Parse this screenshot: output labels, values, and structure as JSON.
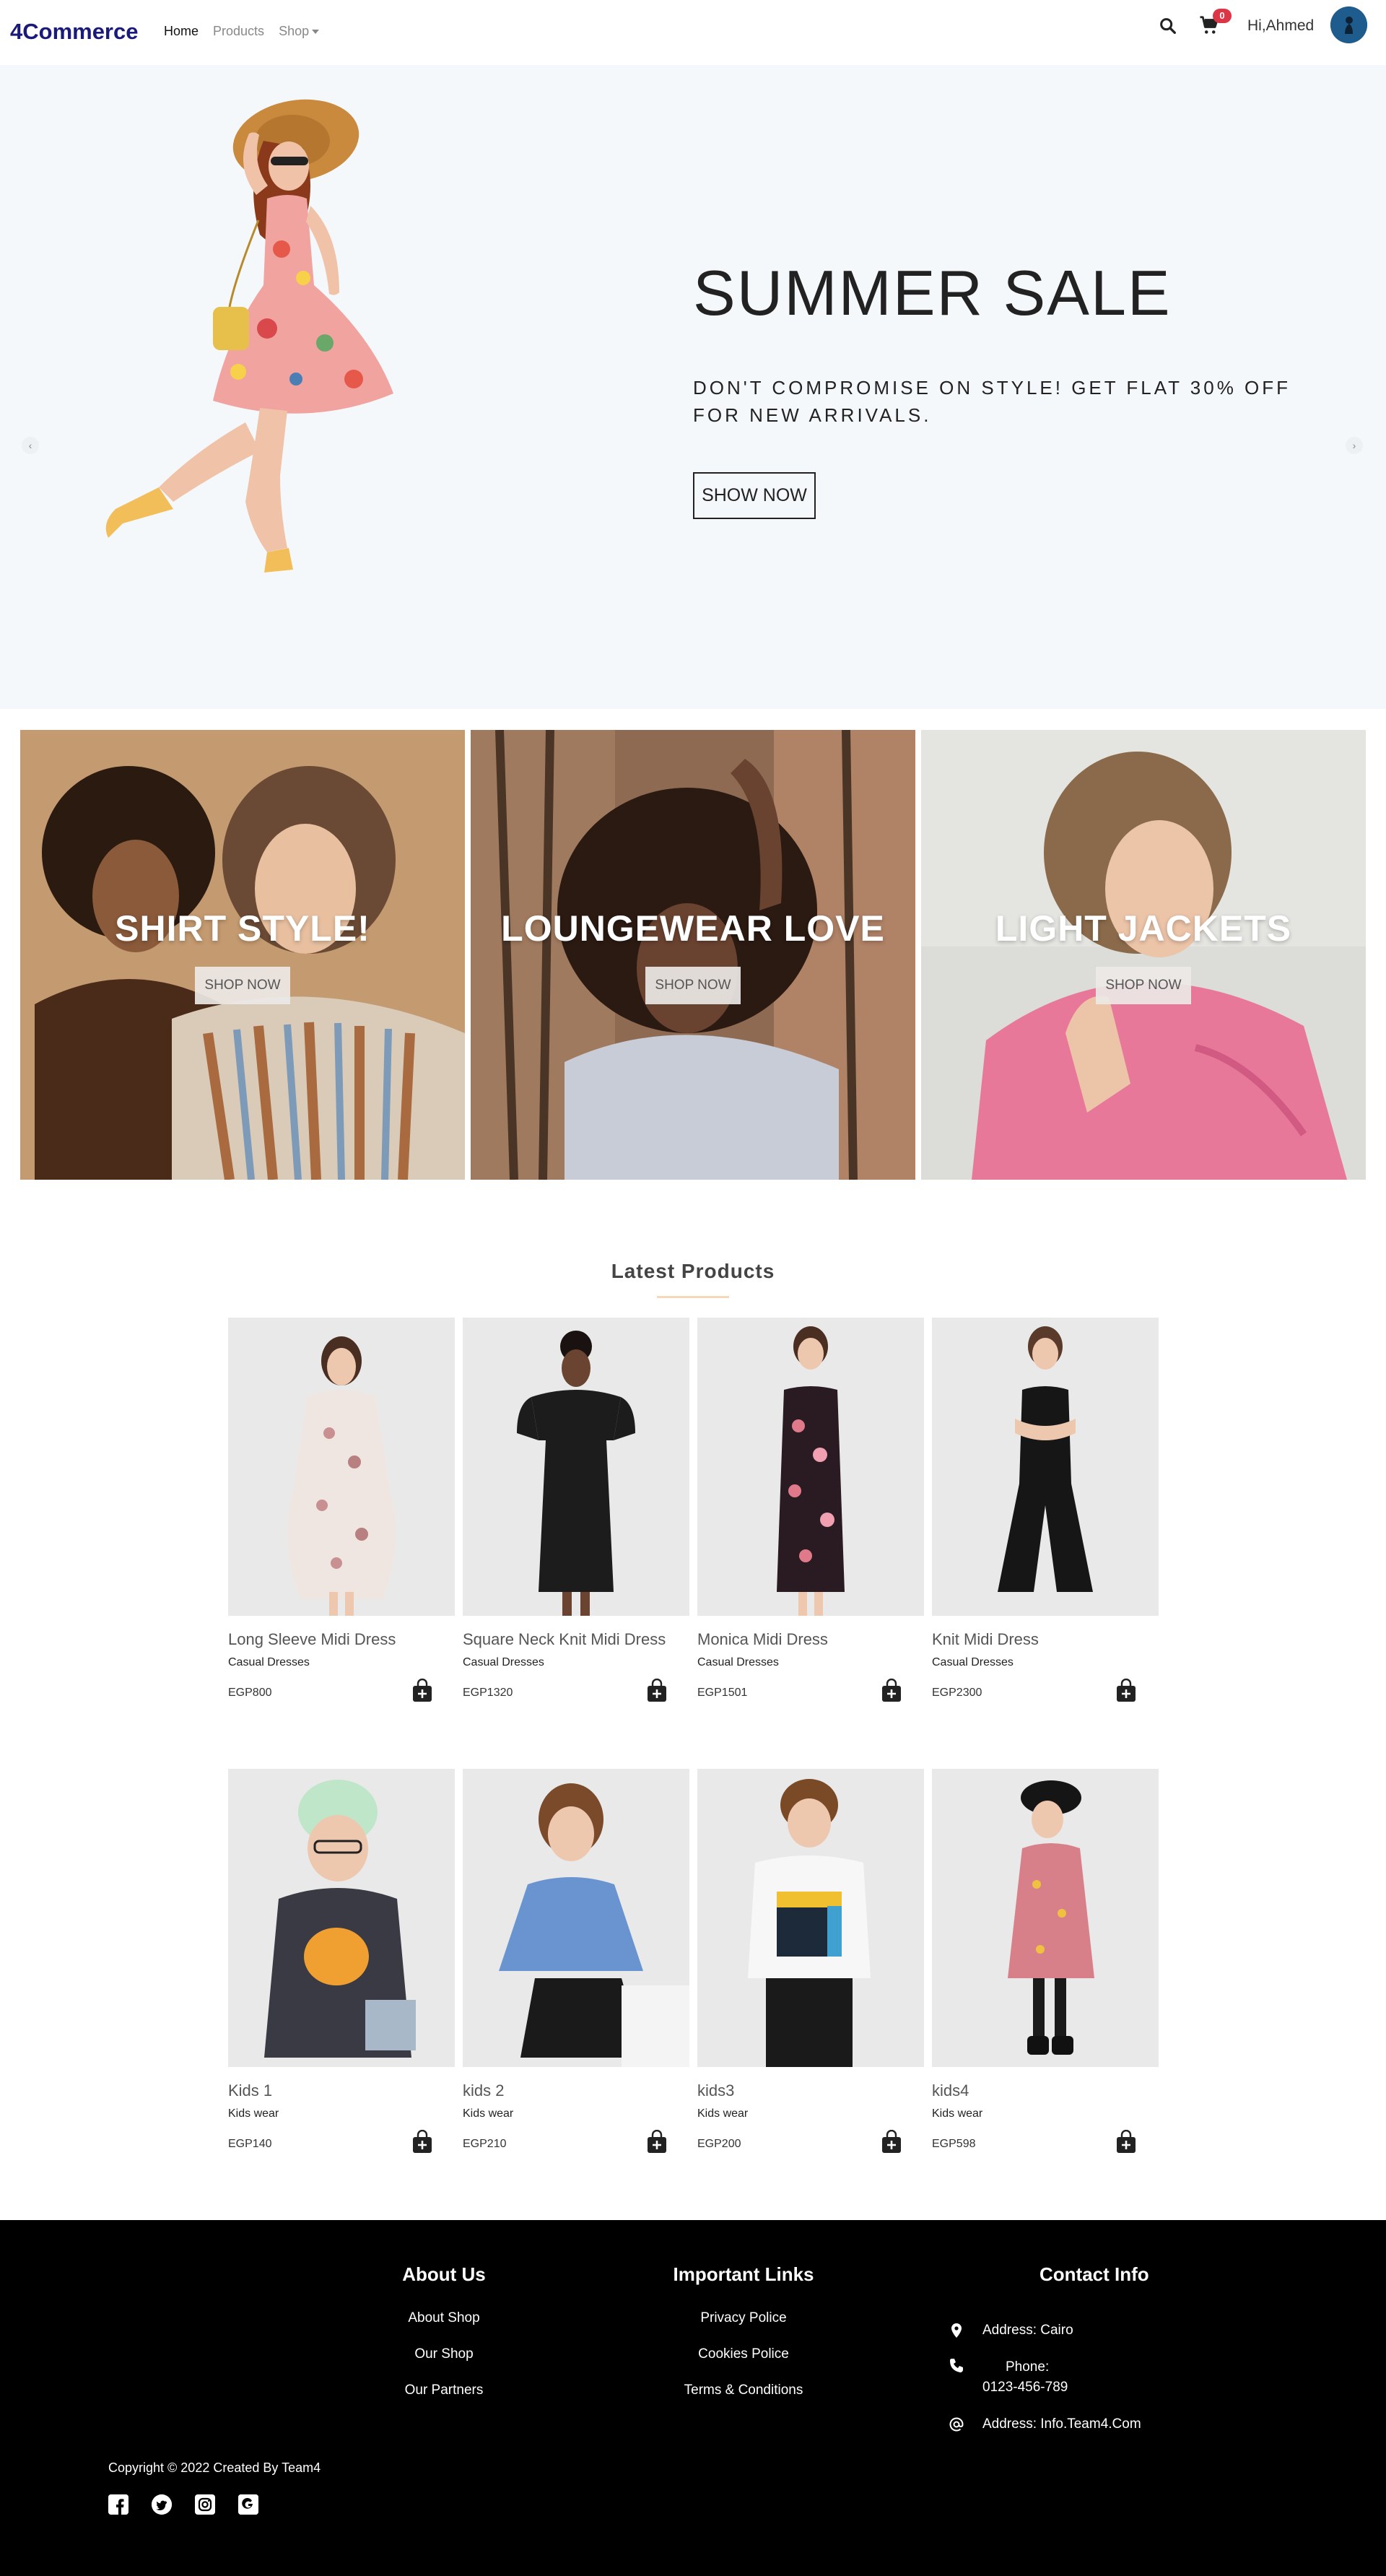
{
  "navbar": {
    "brand": "4Commerce",
    "links": [
      "Home",
      "Products",
      "Shop"
    ],
    "cart_count": "0",
    "greeting": "Hi,Ahmed"
  },
  "hero": {
    "title": "SUMMER SALE",
    "subtitle": "DON'T COMPROMISE ON STYLE! GET FLAT 30% OFF FOR NEW ARRIVALS.",
    "button": "SHOW NOW",
    "prev": "‹",
    "next": "›"
  },
  "banners": [
    {
      "title": "SHIRT STYLE!",
      "button": "SHOP NOW"
    },
    {
      "title": "LOUNGEWEAR LOVE",
      "button": "SHOP NOW"
    },
    {
      "title": "LIGHT JACKETS",
      "button": "SHOP NOW"
    }
  ],
  "latest": {
    "title": "Latest Products",
    "products": [
      {
        "name": "Long Sleeve Midi Dress",
        "category": "Casual Dresses",
        "price": "EGP800"
      },
      {
        "name": "Square Neck Knit Midi Dress",
        "category": "Casual Dresses",
        "price": "EGP1320"
      },
      {
        "name": "Monica Midi Dress",
        "category": "Casual Dresses",
        "price": "EGP1501"
      },
      {
        "name": "Knit Midi Dress",
        "category": "Casual Dresses",
        "price": "EGP2300"
      },
      {
        "name": "Kids 1",
        "category": "Kids wear",
        "price": "EGP140"
      },
      {
        "name": "kids 2",
        "category": "Kids wear",
        "price": "EGP210"
      },
      {
        "name": "kids3",
        "category": "Kids wear",
        "price": "EGP200"
      },
      {
        "name": "kids4",
        "category": "Kids wear",
        "price": "EGP598"
      }
    ]
  },
  "footer": {
    "about": {
      "heading": "About Us",
      "links": [
        "About Shop",
        "Our Shop",
        "Our Partners"
      ]
    },
    "important": {
      "heading": "Important Links",
      "links": [
        "Privacy Police",
        "Cookies Police",
        "Terms & Conditions"
      ]
    },
    "contact": {
      "heading": "Contact Info",
      "address": "Address: Cairo",
      "phone_label": "Phone:",
      "phone": "0123-456-789",
      "email": "Address: Info.Team4.Com"
    },
    "copyright": "Copyright © 2022 Created By Team4"
  },
  "colors": {
    "brand": "#1a1a7a",
    "badge": "#dc3545",
    "hero_bg": "#f5f8fb",
    "footer_bg": "#000000"
  }
}
